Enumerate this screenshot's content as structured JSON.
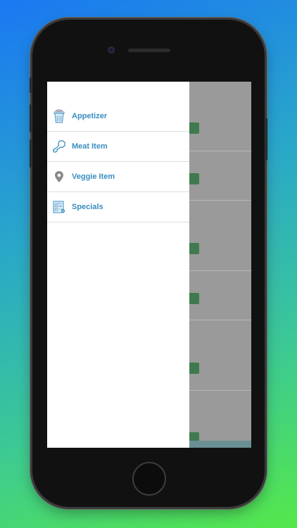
{
  "menu": {
    "items": [
      {
        "label": "Appetizer",
        "icon": "appetizer-icon"
      },
      {
        "label": "Meat Item",
        "icon": "drumstick-icon"
      },
      {
        "label": "Veggie Item",
        "icon": "location-pin-icon"
      },
      {
        "label": "Specials",
        "icon": "specials-icon"
      }
    ]
  },
  "colors": {
    "accent": "#3a8ec0",
    "button_green": "#3f7a4e",
    "overlay_gray": "#9a9a9a"
  }
}
